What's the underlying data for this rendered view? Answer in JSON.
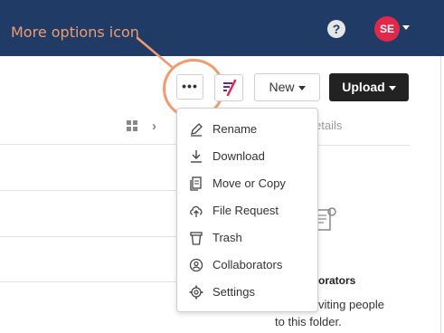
{
  "annotation": {
    "label": "More options icon",
    "accent": "#f29b6c"
  },
  "header": {
    "help_icon": "?",
    "avatar_initials": "SE",
    "background": "#1f3b66"
  },
  "toolbar": {
    "more_label": "•••",
    "new_label": "New",
    "upload_label": "Upload"
  },
  "sidepanel": {
    "details_tab": "etails",
    "collaborators_title": "orators",
    "collaborators_text_1": "viting people",
    "collaborators_text_2": "to this folder."
  },
  "menu": {
    "items": [
      {
        "label": "Rename",
        "icon": "pencil-icon"
      },
      {
        "label": "Download",
        "icon": "download-icon"
      },
      {
        "label": "Move or Copy",
        "icon": "copy-icon"
      },
      {
        "label": "File Request",
        "icon": "cloud-upload-icon"
      },
      {
        "label": "Trash",
        "icon": "trash-icon"
      },
      {
        "label": "Collaborators",
        "icon": "user-circle-icon"
      },
      {
        "label": "Settings",
        "icon": "gear-icon"
      }
    ]
  }
}
